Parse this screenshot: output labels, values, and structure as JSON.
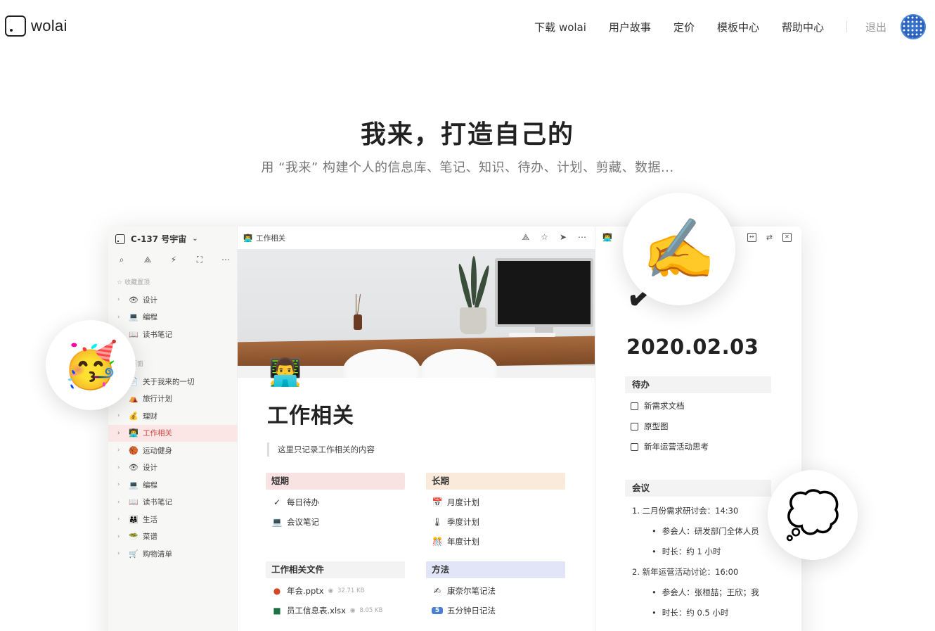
{
  "nav": {
    "logo_text": "wolai",
    "links": [
      "下载 wolai",
      "用户故事",
      "定价",
      "模板中心",
      "帮助中心"
    ],
    "logout": "退出"
  },
  "hero": {
    "title": "我来，打造自己的",
    "subtitle": "用 “我来” 构建个人的信息库、笔记、知识、待办、计划、剪藏、数据..."
  },
  "sidebar": {
    "workspace": "C-137 号宇宙",
    "favorites_header": "收藏置顶",
    "favorites": [
      {
        "icon": "👁",
        "label": "设计"
      },
      {
        "icon": "💻",
        "label": "编程"
      },
      {
        "icon": "📖",
        "label": "读书笔记"
      }
    ],
    "pages_header": "页面",
    "pages": [
      {
        "icon": "📄",
        "label": "关于我来的一切"
      },
      {
        "icon": "⛺",
        "label": "旅行计划"
      },
      {
        "icon": "💰",
        "label": "理财"
      },
      {
        "icon": "👨‍💻",
        "label": "工作相关"
      },
      {
        "icon": "🏀",
        "label": "运动健身"
      },
      {
        "icon": "👁",
        "label": "设计"
      },
      {
        "icon": "💻",
        "label": "编程"
      },
      {
        "icon": "📖",
        "label": "读书笔记"
      },
      {
        "icon": "👨‍👩‍👧",
        "label": "生活"
      },
      {
        "icon": "🥗",
        "label": "菜谱"
      },
      {
        "icon": "🛒",
        "label": "购物清单"
      }
    ]
  },
  "main": {
    "crumb": "工作相关",
    "title": "工作相关",
    "quote": "这里只记录工作相关的内容",
    "short": {
      "head": "短期",
      "items": [
        {
          "icon": "✓",
          "label": "每日待办"
        },
        {
          "icon": "💻",
          "label": "会议笔记"
        }
      ]
    },
    "long": {
      "head": "长期",
      "items": [
        {
          "icon": "📅",
          "label": "月度计划"
        },
        {
          "icon": "🌡",
          "label": "季度计划"
        },
        {
          "icon": "🎊",
          "label": "年度计划"
        }
      ]
    },
    "files": {
      "head": "工作相关文件",
      "items": [
        {
          "label": "年会.pptx",
          "size": "32.71 KB"
        },
        {
          "label": "员工信息表.xlsx",
          "size": "8.05 KB"
        }
      ]
    },
    "methods": {
      "head": "方法",
      "items": [
        {
          "icon": "✍",
          "label": "康奈尔笔记法"
        },
        {
          "icon": "5",
          "label": "五分钟日记法"
        }
      ]
    }
  },
  "right": {
    "date": "2020.02.03",
    "todo_head": "待办",
    "todos": [
      "新需求文档",
      "原型图",
      "新年运营活动思考"
    ],
    "meeting_head": "会议",
    "meetings": [
      {
        "title": "1.  二月份需求研讨会：14:30",
        "bullets": [
          "参会人：研发部门全体人员",
          "时长：约 1 小时"
        ]
      },
      {
        "title": "2.  新年运营活动讨论：16:00",
        "bullets": [
          "参会人：张桓喆；王欣；我",
          "时长：约 0.5 小时"
        ]
      }
    ]
  },
  "colors": {
    "short_head": "#f9e2e2",
    "long_head": "#faeadc",
    "files_head": "#f3f3f3",
    "methods_head": "#e2e4f8",
    "active_item": "#fbe5e5"
  }
}
